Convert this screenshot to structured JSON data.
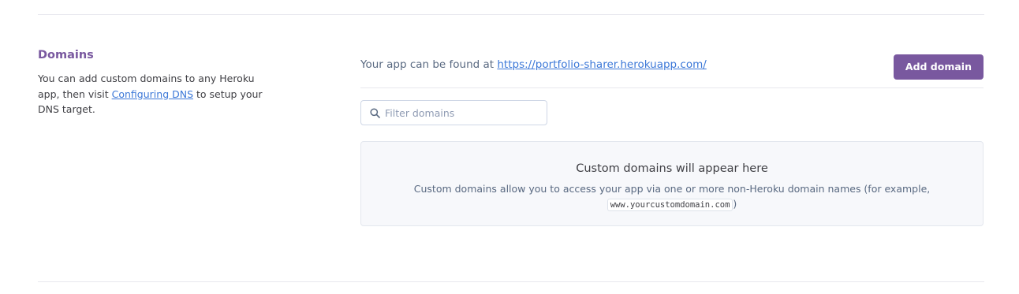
{
  "section": {
    "title": "Domains",
    "description_part1": "You can add custom domains to any Heroku app, then visit ",
    "description_link": "Configuring DNS",
    "description_part2": " to setup your DNS target."
  },
  "app_url": {
    "prefix": "Your app can be found at ",
    "url": "https://portfolio-sharer.herokuapp.com/"
  },
  "actions": {
    "add_domain_label": "Add domain"
  },
  "filter": {
    "placeholder": "Filter domains",
    "value": ""
  },
  "empty_state": {
    "title": "Custom domains will appear here",
    "description": "Custom domains allow you to access your app via one or more non-Heroku domain names (for example,",
    "example_domain": "www.yourcustomdomain.com",
    "closing": ")"
  },
  "icons": {
    "search": "search-icon"
  },
  "colors": {
    "accent": "#79589f",
    "link": "#3c78d8"
  }
}
